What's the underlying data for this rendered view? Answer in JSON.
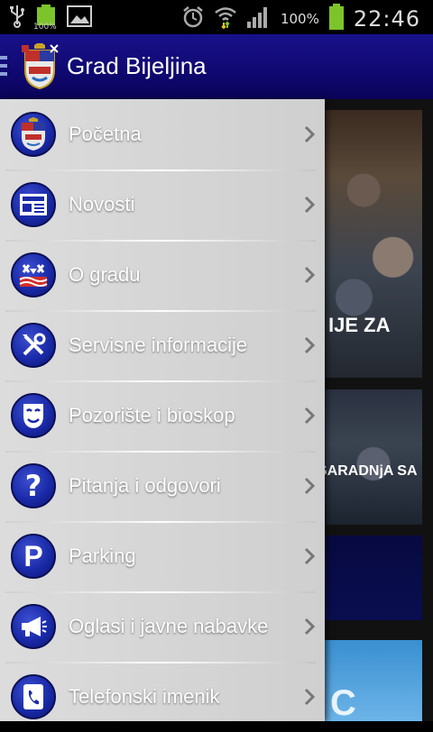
{
  "status_bar": {
    "battery_small_label": "100%",
    "battery_percent": "100%",
    "time": "22:46",
    "icons": [
      "usb-icon",
      "battery-small-icon",
      "image-icon",
      "alarm-icon",
      "wifi-icon",
      "signal-icon",
      "battery-icon"
    ]
  },
  "action_bar": {
    "title": "Grad Bijeljina",
    "icon": "coat-of-arms-icon"
  },
  "drawer": {
    "items": [
      {
        "label": "Početna",
        "icon": "coat-of-arms-icon"
      },
      {
        "label": "Novosti",
        "icon": "newspaper-icon"
      },
      {
        "label": "O gradu",
        "icon": "city-emblem-icon"
      },
      {
        "label": "Servisne informacije",
        "icon": "tools-icon"
      },
      {
        "label": "Pozorište i bioskop",
        "icon": "theater-masks-icon"
      },
      {
        "label": "Pitanja i odgovori",
        "icon": "question-icon"
      },
      {
        "label": "Parking",
        "icon": "parking-icon"
      },
      {
        "label": "Oglasi i javne nabavke",
        "icon": "megaphone-icon"
      },
      {
        "label": "Telefonski imenik",
        "icon": "phone-book-icon"
      }
    ]
  },
  "background_content": {
    "card1_caption": "IJE ZA",
    "card2_caption": "SARADNjA SA",
    "card4_caption": "C"
  },
  "colors": {
    "action_bar": "#0f0870",
    "drawer_bg": "#d6d6d6",
    "icon_blue": "#1a2aa8",
    "battery_green": "#7dc42a"
  }
}
